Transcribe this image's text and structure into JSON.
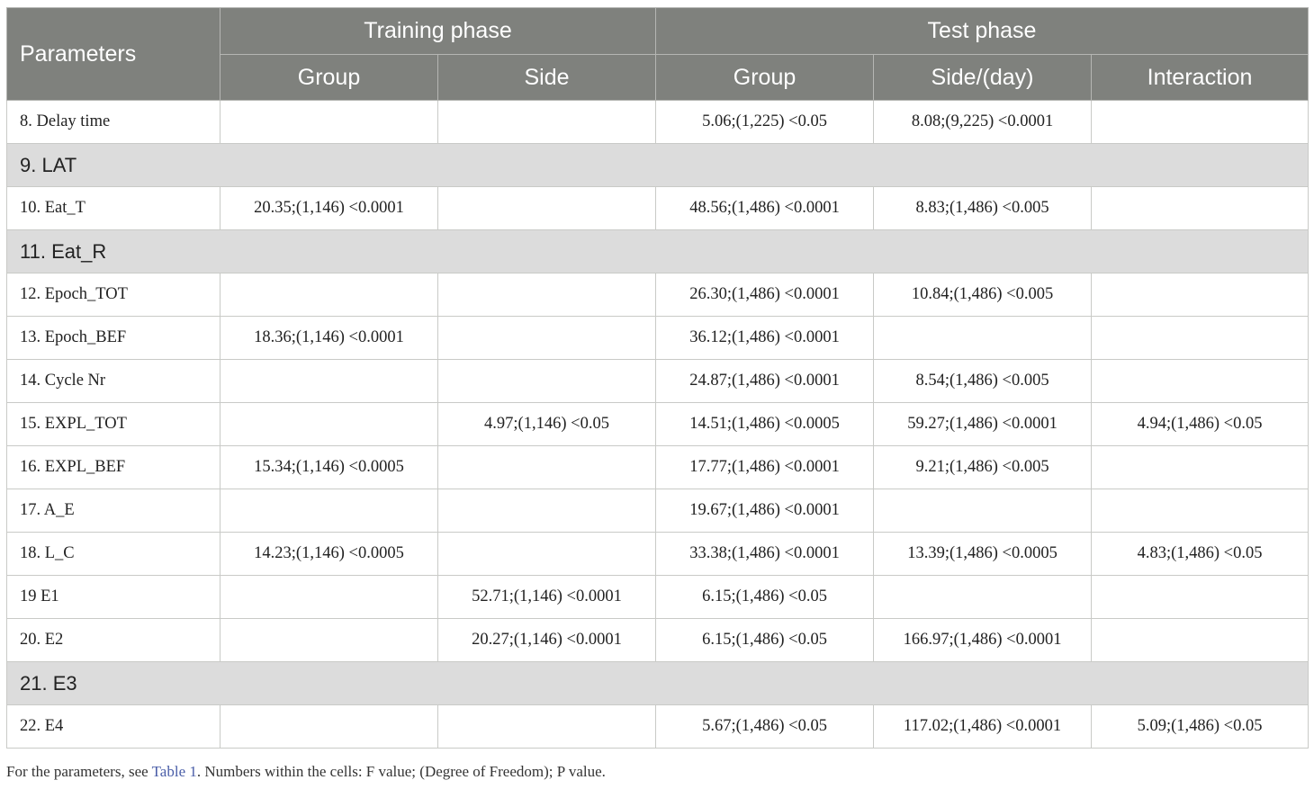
{
  "header": {
    "parameters": "Parameters",
    "training_phase": "Training phase",
    "test_phase": "Test phase",
    "training_group": "Group",
    "training_side": "Side",
    "test_group": "Group",
    "test_side_day": "Side/(day)",
    "test_interaction": "Interaction"
  },
  "rows": {
    "r8": {
      "param": "8. Delay time",
      "tr_group": "",
      "tr_side": "",
      "te_group": "5.06;(1,225) <0.05",
      "te_side": "8.08;(9,225) <0.0001",
      "te_inter": ""
    },
    "r9": {
      "section": "9. LAT"
    },
    "r10": {
      "param": "10. Eat_T",
      "tr_group": "20.35;(1,146) <0.0001",
      "tr_side": "",
      "te_group": "48.56;(1,486) <0.0001",
      "te_side": "8.83;(1,486) <0.005",
      "te_inter": ""
    },
    "r11": {
      "section": "11. Eat_R"
    },
    "r12": {
      "param": "12. Epoch_TOT",
      "tr_group": "",
      "tr_side": "",
      "te_group": "26.30;(1,486) <0.0001",
      "te_side": "10.84;(1,486) <0.005",
      "te_inter": ""
    },
    "r13": {
      "param": "13. Epoch_BEF",
      "tr_group": "18.36;(1,146) <0.0001",
      "tr_side": "",
      "te_group": "36.12;(1,486) <0.0001",
      "te_side": "",
      "te_inter": ""
    },
    "r14": {
      "param": "14. Cycle Nr",
      "tr_group": "",
      "tr_side": "",
      "te_group": "24.87;(1,486) <0.0001",
      "te_side": "8.54;(1,486) <0.005",
      "te_inter": ""
    },
    "r15": {
      "param": "15. EXPL_TOT",
      "tr_group": "",
      "tr_side": "4.97;(1,146) <0.05",
      "te_group": "14.51;(1,486) <0.0005",
      "te_side": "59.27;(1,486) <0.0001",
      "te_inter": "4.94;(1,486) <0.05"
    },
    "r16": {
      "param": "16. EXPL_BEF",
      "tr_group": "15.34;(1,146) <0.0005",
      "tr_side": "",
      "te_group": "17.77;(1,486) <0.0001",
      "te_side": "9.21;(1,486) <0.005",
      "te_inter": ""
    },
    "r17": {
      "param": "17. A_E",
      "tr_group": "",
      "tr_side": "",
      "te_group": "19.67;(1,486) <0.0001",
      "te_side": "",
      "te_inter": ""
    },
    "r18": {
      "param": "18. L_C",
      "tr_group": "14.23;(1,146) <0.0005",
      "tr_side": "",
      "te_group": "33.38;(1,486) <0.0001",
      "te_side": "13.39;(1,486) <0.0005",
      "te_inter": "4.83;(1,486) <0.05"
    },
    "r19": {
      "param": "19 E1",
      "tr_group": "",
      "tr_side": "52.71;(1,146) <0.0001",
      "te_group": "6.15;(1,486) <0.05",
      "te_side": "",
      "te_inter": ""
    },
    "r20": {
      "param": "20. E2",
      "tr_group": "",
      "tr_side": "20.27;(1,146) <0.0001",
      "te_group": "6.15;(1,486) <0.05",
      "te_side": "166.97;(1,486) <0.0001",
      "te_inter": ""
    },
    "r21": {
      "section": "21. E3"
    },
    "r22": {
      "param": "22. E4",
      "tr_group": "",
      "tr_side": "",
      "te_group": "5.67;(1,486) <0.05",
      "te_side": "117.02;(1,486) <0.0001",
      "te_inter": "5.09;(1,486) <0.05"
    }
  },
  "footnote": {
    "pre": "For the parameters, see ",
    "link": "Table 1",
    "post": ". Numbers within the cells: F value; (Degree of Freedom); P value."
  }
}
